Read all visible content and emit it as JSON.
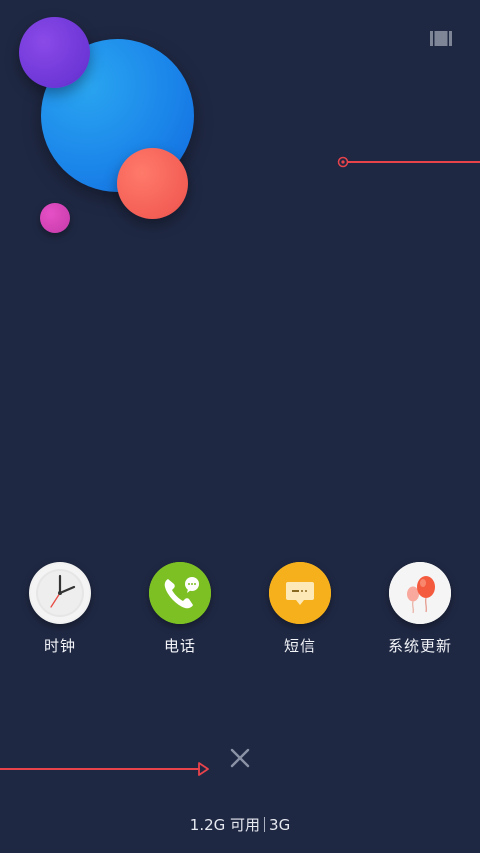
{
  "apps": [
    {
      "label": "时钟",
      "icon": "clock-icon",
      "color": "#f1f1f1"
    },
    {
      "label": "电话",
      "icon": "phone-icon",
      "color": "#7cc024"
    },
    {
      "label": "短信",
      "icon": "message-icon",
      "color": "#f6b01c"
    },
    {
      "label": "系统更新",
      "icon": "system-update-balloon-icon",
      "color": "#f3f3f3"
    }
  ],
  "memory": {
    "available": "1.2G 可用",
    "total": "3G"
  },
  "colors": {
    "background": "#1f2843",
    "accent_line": "#e8434b"
  }
}
